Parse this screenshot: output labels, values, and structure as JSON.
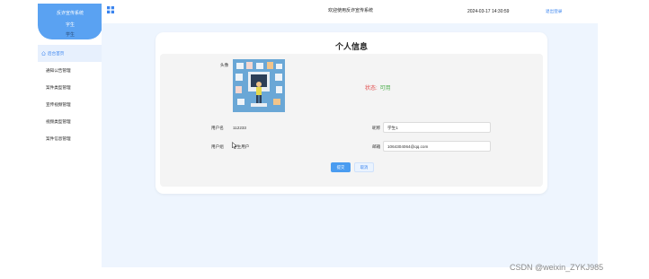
{
  "sidebar": {
    "brand_title": "反诈宣传系统",
    "brand_user": "字生",
    "brand_role": "学生",
    "items": [
      {
        "label": "后台首页",
        "active": true
      },
      {
        "label": "通知公告管理",
        "active": false
      },
      {
        "label": "案件类型管理",
        "active": false
      },
      {
        "label": "宣传视频管理",
        "active": false
      },
      {
        "label": "视频类型管理",
        "active": false
      },
      {
        "label": "案件信息管理",
        "active": false
      }
    ]
  },
  "header": {
    "title": "欢迎使用反诈宣传系统",
    "datetime": "2024-03-17 14:30:59",
    "logout_label": "退出登录"
  },
  "profile": {
    "title": "个人信息",
    "avatar_label": "头像",
    "status_label": "状态:",
    "status_value": "可用",
    "account_label": "用户名",
    "account_value": "112233",
    "nickname_label": "昵称",
    "nickname_value": "学生1",
    "role_label": "用户组",
    "role_value": "学生用户",
    "email_label": "邮箱",
    "email_value": "1064304064@qq.com",
    "submit_label": "提交",
    "cancel_label": "取消"
  },
  "watermark": "CSDN @weixin_ZYKJ985",
  "colors": {
    "accent": "#4a9cf0",
    "sidebar_active_bg": "#e7f0fd",
    "status_disabled": "#e14b4b",
    "status_ok": "#4cae4c",
    "main_bg": "#eef5fe"
  }
}
